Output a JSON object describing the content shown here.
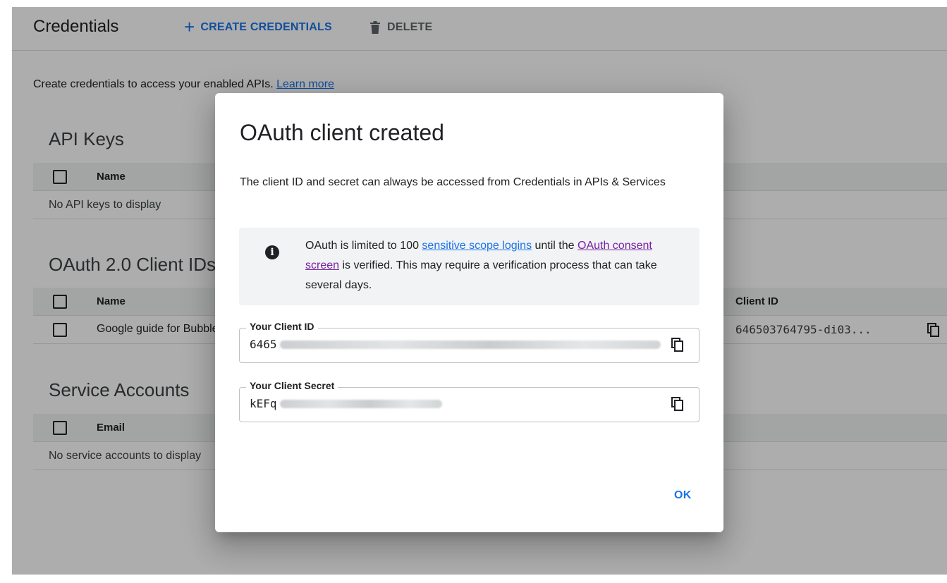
{
  "header": {
    "title": "Credentials",
    "create_label": "CREATE CREDENTIALS",
    "create_icon": "plus-icon",
    "delete_label": "DELETE",
    "delete_icon": "trash-icon"
  },
  "intro": {
    "text": "Create credentials to access your enabled APIs.",
    "link": "Learn more"
  },
  "api_keys": {
    "title": "API Keys",
    "col_name": "Name",
    "empty": "No API keys to display"
  },
  "oauth": {
    "title": "OAuth 2.0 Client IDs",
    "col_name": "Name",
    "col_client_id": "Client ID",
    "rows": [
      {
        "name": "Google guide for Bubble",
        "client_id": "646503764795-di03..."
      }
    ]
  },
  "service_accounts": {
    "title": "Service Accounts",
    "col_email": "Email",
    "empty": "No service accounts to display"
  },
  "dialog": {
    "title": "OAuth client created",
    "description": "The client ID and secret can always be accessed from Credentials in APIs & Services",
    "info": {
      "icon": "info-icon",
      "text_1": "OAuth is limited to 100 ",
      "link_1": "sensitive scope logins",
      "text_2": " until the ",
      "link_2": "OAuth consent screen",
      "text_3": " is verified. This may require a verification process that can take several days."
    },
    "client_id_label": "Your Client ID",
    "client_id_value": "6465",
    "client_secret_label": "Your Client Secret",
    "client_secret_value": "kEFq",
    "copy_icon": "copy-icon",
    "ok_label": "OK"
  },
  "colors": {
    "accent": "#1a73e8",
    "visited_link": "#7b1fa2",
    "scrim": "rgba(0,0,0,0.32)"
  }
}
